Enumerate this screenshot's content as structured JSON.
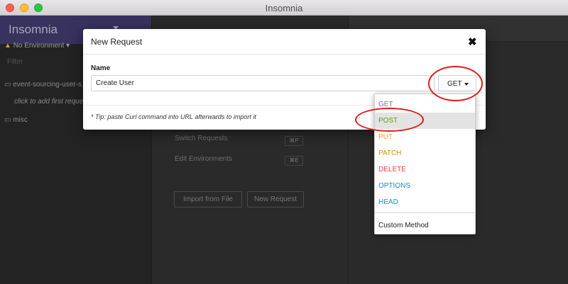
{
  "window": {
    "title": "Insomnia"
  },
  "sidebar": {
    "app_name": "Insomnia",
    "environment": "No Environment",
    "filter_placeholder": "Filter",
    "items": [
      {
        "label": "event-sourcing-user-s..."
      },
      {
        "label": "click to add first reque..."
      },
      {
        "label": "misc"
      }
    ]
  },
  "center": {
    "shortcuts": [
      {
        "label": "Switch Requests",
        "key": "⌘P"
      },
      {
        "label": "Edit Environments",
        "key": "⌘E"
      }
    ],
    "buttons": {
      "import": "Import from File",
      "new_request": "New Request"
    }
  },
  "modal": {
    "title": "New Request",
    "close_symbol": "✖",
    "name_label": "Name",
    "name_value": "Create User",
    "method": "GET",
    "tip": "* Tip: paste Curl command into URL afterwards to import it"
  },
  "dropdown": {
    "options": [
      {
        "label": "GET",
        "color": "#7d69cb"
      },
      {
        "label": "POST",
        "color": "#59a210"
      },
      {
        "label": "PUT",
        "color": "#ff9a1f"
      },
      {
        "label": "PATCH",
        "color": "#c99a0e"
      },
      {
        "label": "DELETE",
        "color": "#e8434a"
      },
      {
        "label": "OPTIONS",
        "color": "#1c90b4"
      },
      {
        "label": "HEAD",
        "color": "#1c90b4"
      }
    ],
    "custom": "Custom Method"
  },
  "colors": {
    "sidebar_brand": "#38325e",
    "annotation": "#e01b1b"
  }
}
